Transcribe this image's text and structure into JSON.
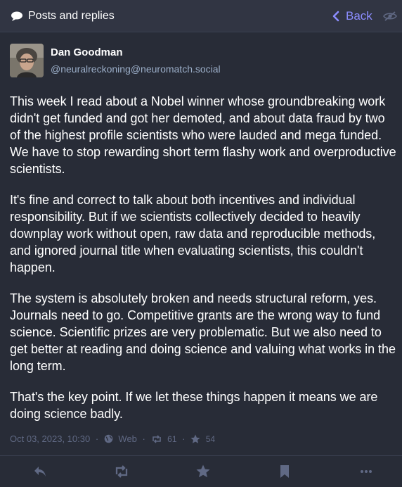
{
  "header": {
    "title": "Posts and replies",
    "back_label": "Back",
    "title_icon": "speech-bubble-icon",
    "back_icon": "chevron-left-icon",
    "visibility_icon": "eye-slash-icon"
  },
  "account": {
    "display_name": "Dan Goodman",
    "acct": "@neuralreckoning@neuromatch.social"
  },
  "post": {
    "paragraphs": [
      "This week I read about a Nobel winner whose groundbreaking work didn't get funded and got her demoted, and about data fraud by two of the highest profile scientists who were lauded and mega funded. We have to stop rewarding short term flashy work and overproductive scientists.",
      "It's fine and correct to talk about both incentives and individual responsibility. But if we scientists collectively decided to heavily downplay work without open, raw data and reproducible methods, and ignored journal title when evaluating scientists, this couldn't happen.",
      "The system is absolutely broken and needs structural reform, yes. Journals need to go. Competitive grants are the wrong way to fund science. Scientific prizes are very problematic. But we also need to get better at reading and doing science and valuing what works in the long term.",
      "That's the key point. If we let these things happen it means we are doing science badly."
    ],
    "timestamp": "Oct 03, 2023, 10:30",
    "separator": "·",
    "visibility": "Web",
    "boosts": "61",
    "favourites": "54"
  },
  "actions": {
    "reply_icon": "reply-icon",
    "boost_icon": "retweet-icon",
    "favourite_icon": "star-icon",
    "bookmark_icon": "bookmark-icon",
    "more_icon": "ellipsis-icon"
  },
  "colors": {
    "background": "#282c37",
    "header": "#313543",
    "accent": "#8c8dff",
    "muted": "#606984",
    "secondary_text": "#9baec8"
  }
}
